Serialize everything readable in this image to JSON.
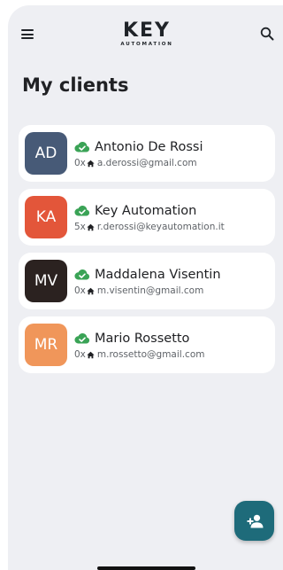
{
  "header": {
    "logo_main": "KEY",
    "logo_sub": "AUTOMATION"
  },
  "page": {
    "title": "My clients"
  },
  "clients": [
    {
      "initials": "AD",
      "name": "Antonio De Rossi",
      "count": "0x",
      "email": "a.derossi@gmail.com",
      "color": "#475a77"
    },
    {
      "initials": "KA",
      "name": "Key Automation",
      "count": "5x",
      "email": "r.derossi@keyautomation.it",
      "color": "#e3563a"
    },
    {
      "initials": "MV",
      "name": "Maddalena Visentin",
      "count": "0x",
      "email": "m.visentin@gmail.com",
      "color": "#2b2220"
    },
    {
      "initials": "MR",
      "name": "Mario Rossetto",
      "count": "0x",
      "email": "m.rossetto@gmail.com",
      "color": "#f0965a"
    }
  ],
  "colors": {
    "background": "#eeeff3",
    "card": "#ffffff",
    "status_green": "#3aa356",
    "fab": "#1e6b7a"
  },
  "icons": {
    "menu": "menu-icon",
    "search": "search-icon",
    "status": "cloud-check-icon",
    "home": "home-icon",
    "add_client": "add-person-icon"
  }
}
